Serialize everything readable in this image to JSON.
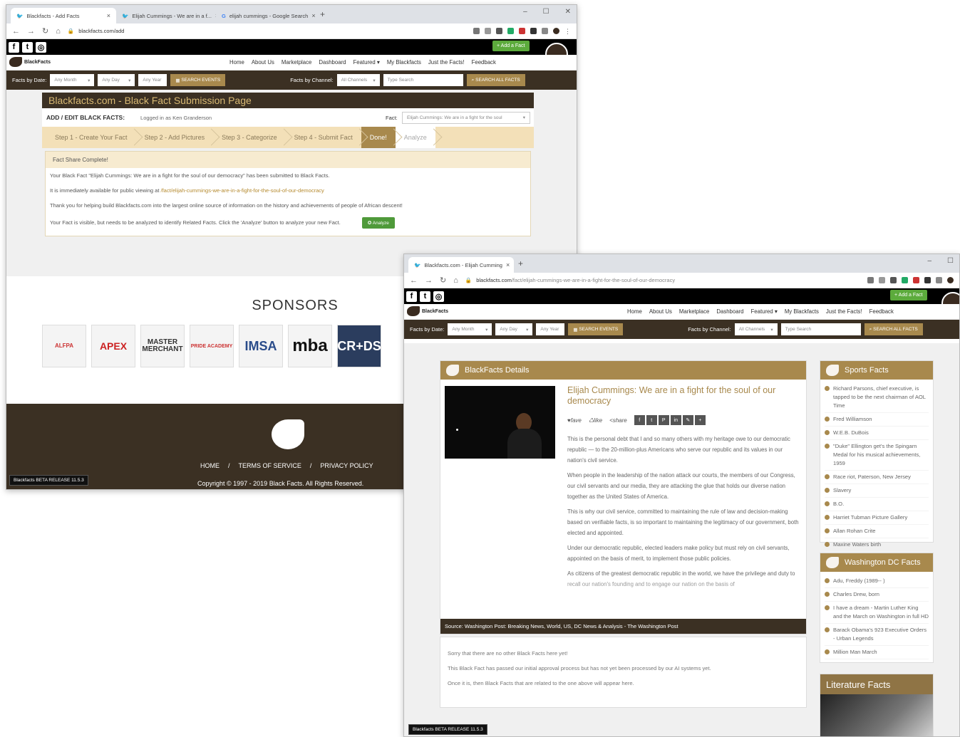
{
  "window1": {
    "tabs": [
      {
        "title": "Blackfacts - Add Facts"
      },
      {
        "title": "Elijah Cummings - We are in a f..."
      },
      {
        "title": "elijah cummings - Google Search"
      }
    ],
    "url": "blackfacts.com/add",
    "add_fact": "+ Add a Fact",
    "logo_text": "BlackFacts",
    "nav": [
      "Home",
      "About Us",
      "Marketplace",
      "Dashboard",
      "Featured ▾",
      "My Blackfacts",
      "Just the Facts!",
      "Feedback"
    ],
    "search": {
      "by_date_label": "Facts by Date:",
      "month": "Any Month",
      "day": "Any Day",
      "year": "Any Year",
      "search_events": "SEARCH EVENTS",
      "by_channel_label": "Facts by Channel:",
      "channel": "All Channels",
      "type_search": "Type Search",
      "search_all": "SEARCH ALL FACTS"
    },
    "panel_title": "Blackfacts.com - Black Fact Submission Page",
    "add_edit_label": "ADD / EDIT BLACK FACTS:",
    "logged_in": "Logged in as Ken Granderson",
    "fact_label": "Fact:",
    "fact_value": "Elijah Cummings: We are in a fight for the soul",
    "steps": [
      "Step 1 - Create Your Fact",
      "Step 2 - Add Pictures",
      "Step 3 - Categorize",
      "Step 4 - Submit Fact",
      "Done!",
      "Analyze"
    ],
    "complete_title": "Fact Share Complete!",
    "msg1": "Your Black Fact \"Elijah Cummings: We are in a fight for the soul of our democracy\" has been submitted to Black Facts.",
    "msg2_prefix": "It is immediately available for public viewing at ",
    "msg2_link": "/fact/elijah-cummings-we-are-in-a-fight-for-the-soul-of-our-democracy",
    "msg3": "Thank you for helping build Blackfacts.com into the largest online source of information on the history and achievements of people of African descent!",
    "msg4": "Your Fact is visible, but needs to be analyzed to identify Related Facts. Click the 'Analyze' button to analyze your new Fact.",
    "analyze_btn": "✪ Analyze",
    "sponsors_title": "SPONSORS",
    "sponsors": [
      "ALFPA",
      "APEX",
      "MASTER MERCHANT",
      "PRIDE ACADEMY",
      "IMSA",
      "mba",
      "CR+DS"
    ],
    "footer_links": [
      "HOME",
      "/",
      "TERMS OF SERVICE",
      "/",
      "PRIVACY POLICY"
    ],
    "copyright": "Copyright © 1997 - 2019 Black Facts. All Rights Reserved.",
    "beta": "Blackfacts BETA RELEASE 11.5.3"
  },
  "window2": {
    "tab": "Blackfacts.com - Elijah Cumming",
    "url_host": "blackfacts.com",
    "url_path": "/fact/elijah-cummings-we-are-in-a-fight-for-the-soul-of-our-democracy",
    "details_title": "BlackFacts Details",
    "article_title": "Elijah Cummings: We are in a fight for the soul of our democracy",
    "actions": [
      "♥fave",
      "♺like",
      "<share"
    ],
    "share_icons": [
      "f",
      "t",
      "P",
      "in",
      "✎",
      "+"
    ],
    "paragraphs": [
      "This is the personal debt that I and so many others with my heritage owe to our democratic republic — to the 20-million-plus Americans who serve our republic and its values in our nation's civil service.",
      "When people in the leadership of the nation attack our courts, the members of our Congress, our civil servants and our media, they are attacking the glue that holds our diverse nation together as the United States of America.",
      "This is why our civil service, committed to maintaining the rule of law and decision-making based on verifiable facts, is so important to maintaining the legitimacy of our government, both elected and appointed.",
      "Under our democratic republic, elected leaders make policy but must rely on civil servants, appointed on the basis of merit, to implement those public policies.",
      "As citizens of the greatest democratic republic in the world, we have the privilege and duty to recall our nation's founding and to engage our nation on the basis of"
    ],
    "source": "Source: Washington Post: Breaking News, World, US, DC News & Analysis - The Washington Post",
    "related": [
      "Sorry that there are no other Black Facts here yet!",
      "This Black Fact has passed our initial approval process but has not yet been processed by our AI systems yet.",
      "Once it is, then Black Facts that are related to the one above will appear here."
    ],
    "sports_title": "Sports Facts",
    "sports": [
      "Richard Parsons, chief executive, is tapped to be the next chairman of AOL Time",
      "Fred Williamson",
      "W.E.B. DuBois",
      "\"Duke\" Ellington get's the Spingarn Medal for his musical achievements, 1959",
      "Race riot, Paterson, New Jersey",
      "Slavery",
      "B.O.",
      "Harriet Tubman Picture Gallery",
      "Allan Rohan Crite",
      "Maxine Waters birth"
    ],
    "dc_title": "Washington DC Facts",
    "dc": [
      "Adu, Freddy (1989-- )",
      "Charles Drew, born",
      "I have a dream - Martin Luther King and the March on Washington in full HD",
      "Barack Obama's 923 Executive Orders - Urban Legends",
      "Million Man March"
    ],
    "lit_title": "Literature Facts",
    "beta": "Blackfacts BETA RELEASE 11.5.3"
  }
}
